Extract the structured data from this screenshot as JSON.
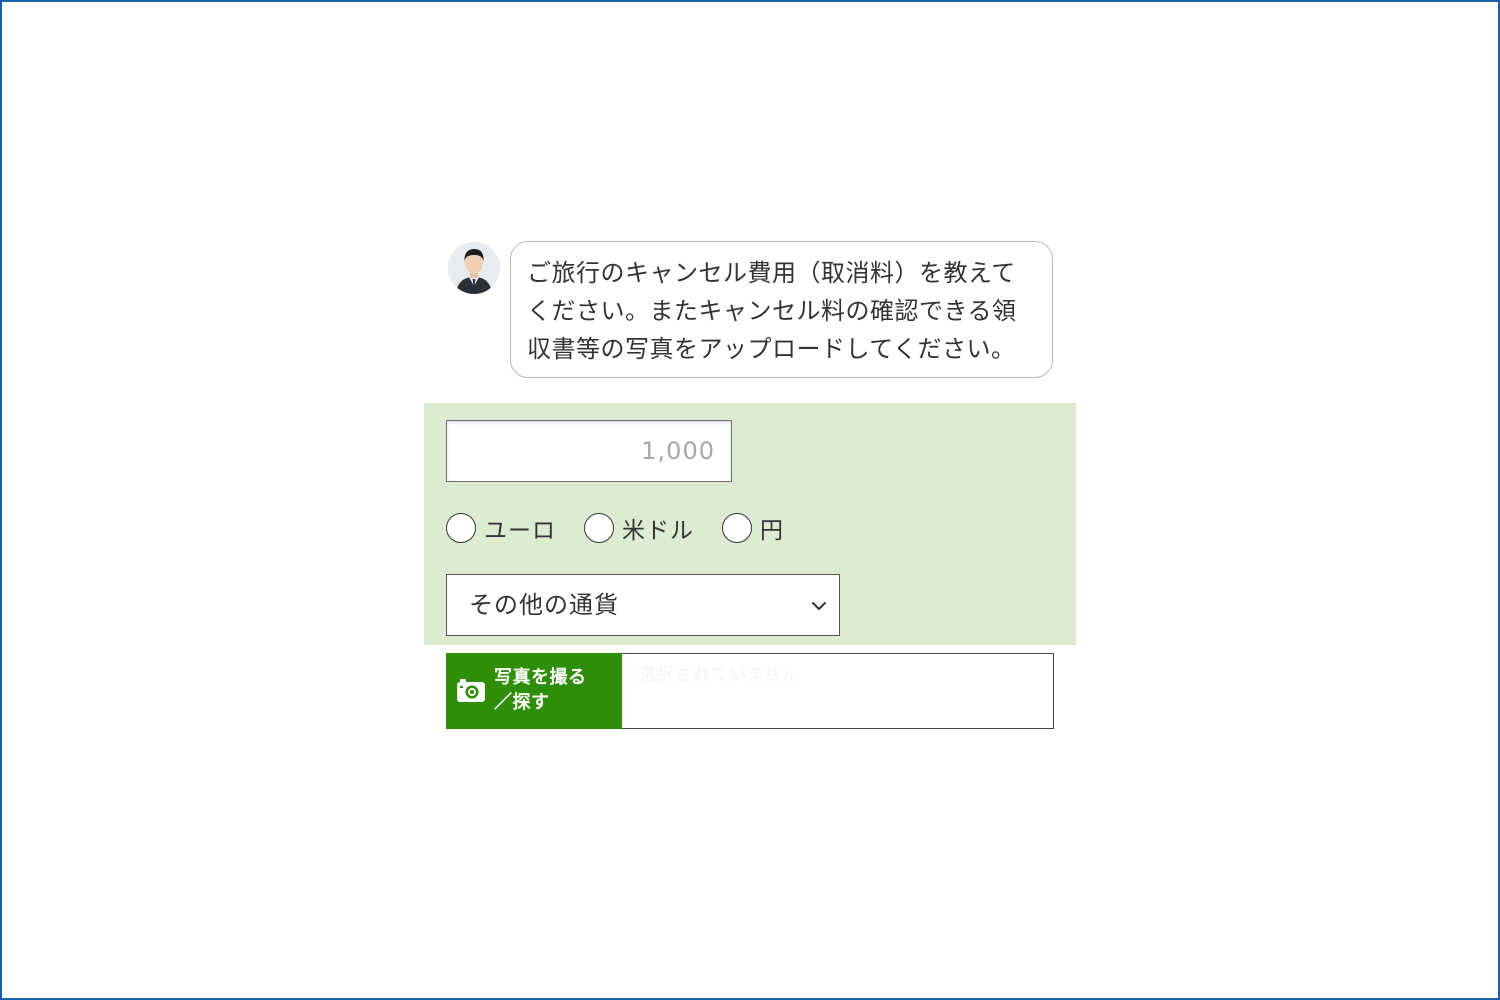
{
  "chat": {
    "avatar_icon": "person-avatar-icon",
    "message": "ご旅行のキャンセル費用（取消料）を教えて\nください。またキャンセル料の確認できる領\n収書等の写真をアップロードしてください。"
  },
  "form": {
    "amount_placeholder": "1,000",
    "currency_options": [
      {
        "label": "ユーロ"
      },
      {
        "label": "米ドル"
      },
      {
        "label": "円"
      }
    ],
    "other_currency_select": {
      "selected": "その他の通貨",
      "icon": "chevron-down-icon"
    }
  },
  "upload": {
    "button_label": "写真を撮る\n／探す",
    "button_icon": "camera-icon",
    "file_status": "選択されていません"
  },
  "colors": {
    "panel_bg": "#dcecd3",
    "button_green": "#2e8e06",
    "frame_border": "#1f5fb0"
  }
}
